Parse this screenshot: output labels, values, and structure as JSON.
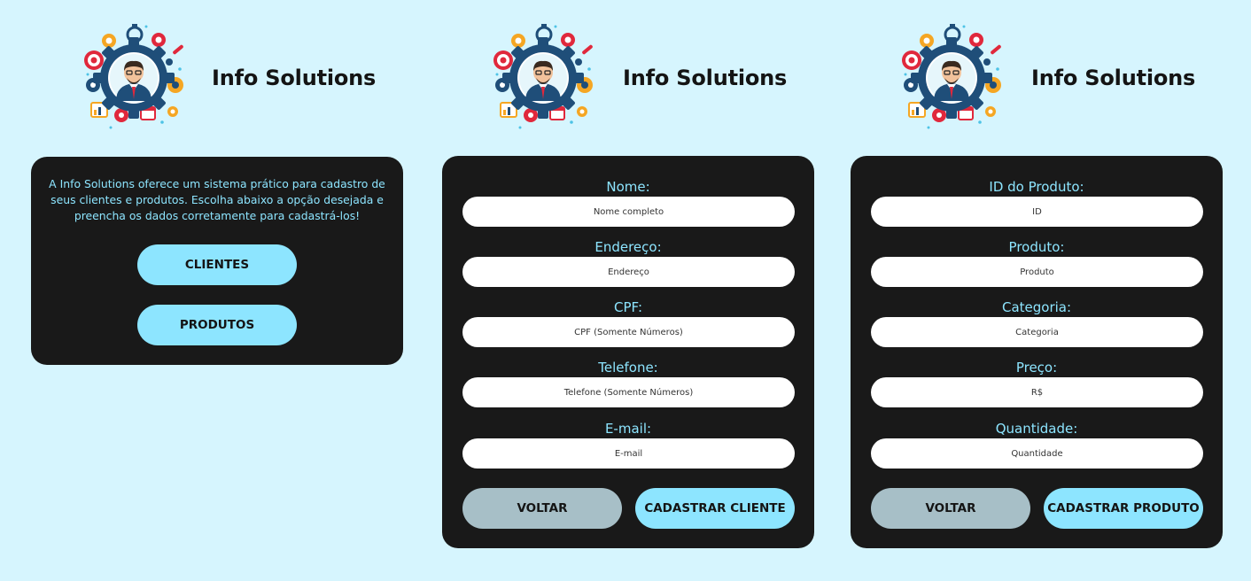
{
  "brand": {
    "name": "Info Solutions"
  },
  "home": {
    "intro": "A Info Solutions oferece um sistema prático para cadastro de seus clientes e produtos. Escolha abaixo a opção desejada e preencha os dados corretamente para cadastrá-los!",
    "buttons": {
      "clients": "CLIENTES",
      "products": "PRODUTOS"
    }
  },
  "client_form": {
    "fields": [
      {
        "label": "Nome:",
        "placeholder": "Nome completo"
      },
      {
        "label": "Endereço:",
        "placeholder": "Endereço"
      },
      {
        "label": "CPF:",
        "placeholder": "CPF (Somente Números)"
      },
      {
        "label": "Telefone:",
        "placeholder": "Telefone (Somente Números)"
      },
      {
        "label": "E-mail:",
        "placeholder": "E-mail"
      }
    ],
    "back_label": "VOLTAR",
    "submit_label": "CADASTRAR CLIENTE"
  },
  "product_form": {
    "fields": [
      {
        "label": "ID do Produto:",
        "placeholder": "ID"
      },
      {
        "label": "Produto:",
        "placeholder": "Produto"
      },
      {
        "label": "Categoria:",
        "placeholder": "Categoria"
      },
      {
        "label": "Preço:",
        "placeholder": "R$"
      },
      {
        "label": "Quantidade:",
        "placeholder": "Quantidade"
      }
    ],
    "back_label": "VOLTAR",
    "submit_label": "CADASTRAR PRODUTO"
  },
  "colors": {
    "background": "#d6f5fe",
    "panel": "#191919",
    "accent": "#8de5ff",
    "secondary_button": "#a7bfc7"
  },
  "icons": {
    "logo": "businessman-gears-icon"
  }
}
